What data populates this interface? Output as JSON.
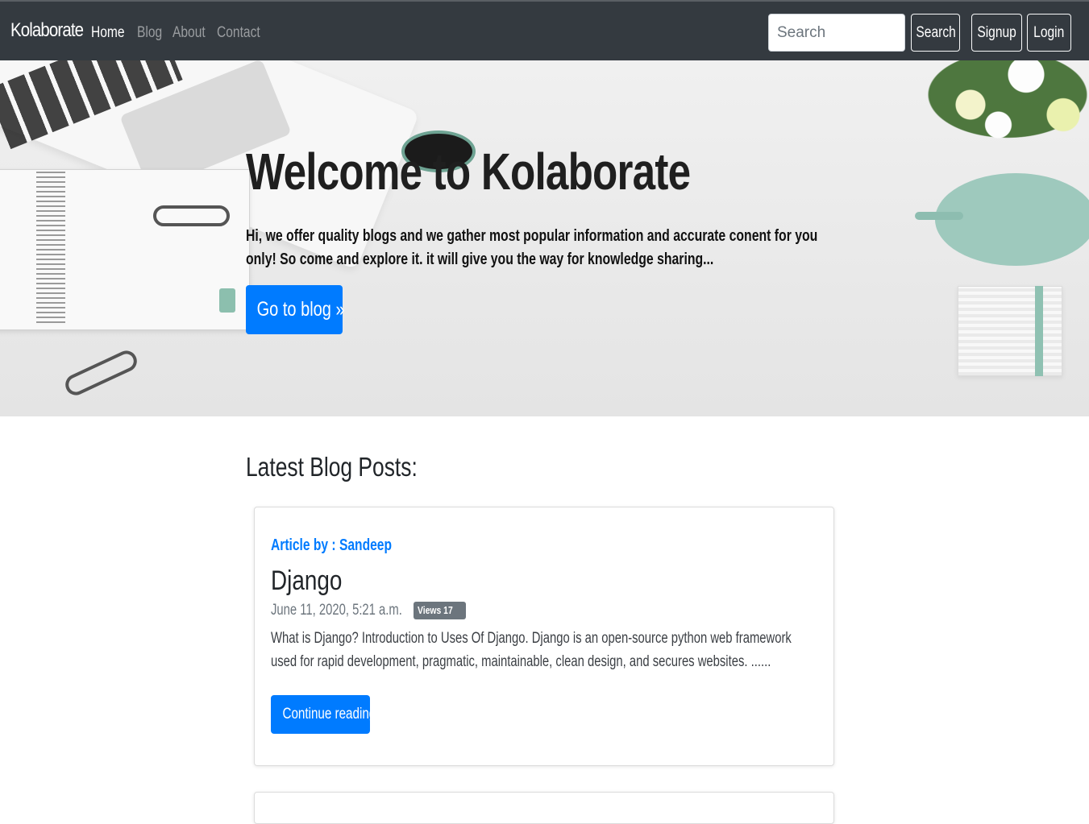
{
  "navbar": {
    "brand": "Kolaborate",
    "links": [
      "Home",
      "Blog",
      "About",
      "Contact"
    ],
    "search_placeholder": "Search",
    "search_button": "Search",
    "signup_button": "Signup",
    "login_button": "Login"
  },
  "hero": {
    "title": "Welcome to Kolaborate",
    "text": "Hi, we offer quality blogs and we gather most popular information and accurate conent for you only! So come and explore it. it will give you the way for knowledge sharing...",
    "button": "Go to blog »"
  },
  "main": {
    "section_title": "Latest Blog Posts:",
    "posts": [
      {
        "author": "Article by : Sandeep",
        "title": "Django",
        "date": "June 11, 2020, 5:21 a.m.",
        "views": "Views 17",
        "excerpt": "What is Django? Introduction to Uses Of Django. Django is an open-source python web framework used for rapid development, pragmatic, maintainable, clean design, and secures websites. ......",
        "button": "Continue reading"
      }
    ]
  },
  "colors": {
    "navbar_bg": "#343a40",
    "primary": "#007bff",
    "badge": "#6c757d"
  }
}
